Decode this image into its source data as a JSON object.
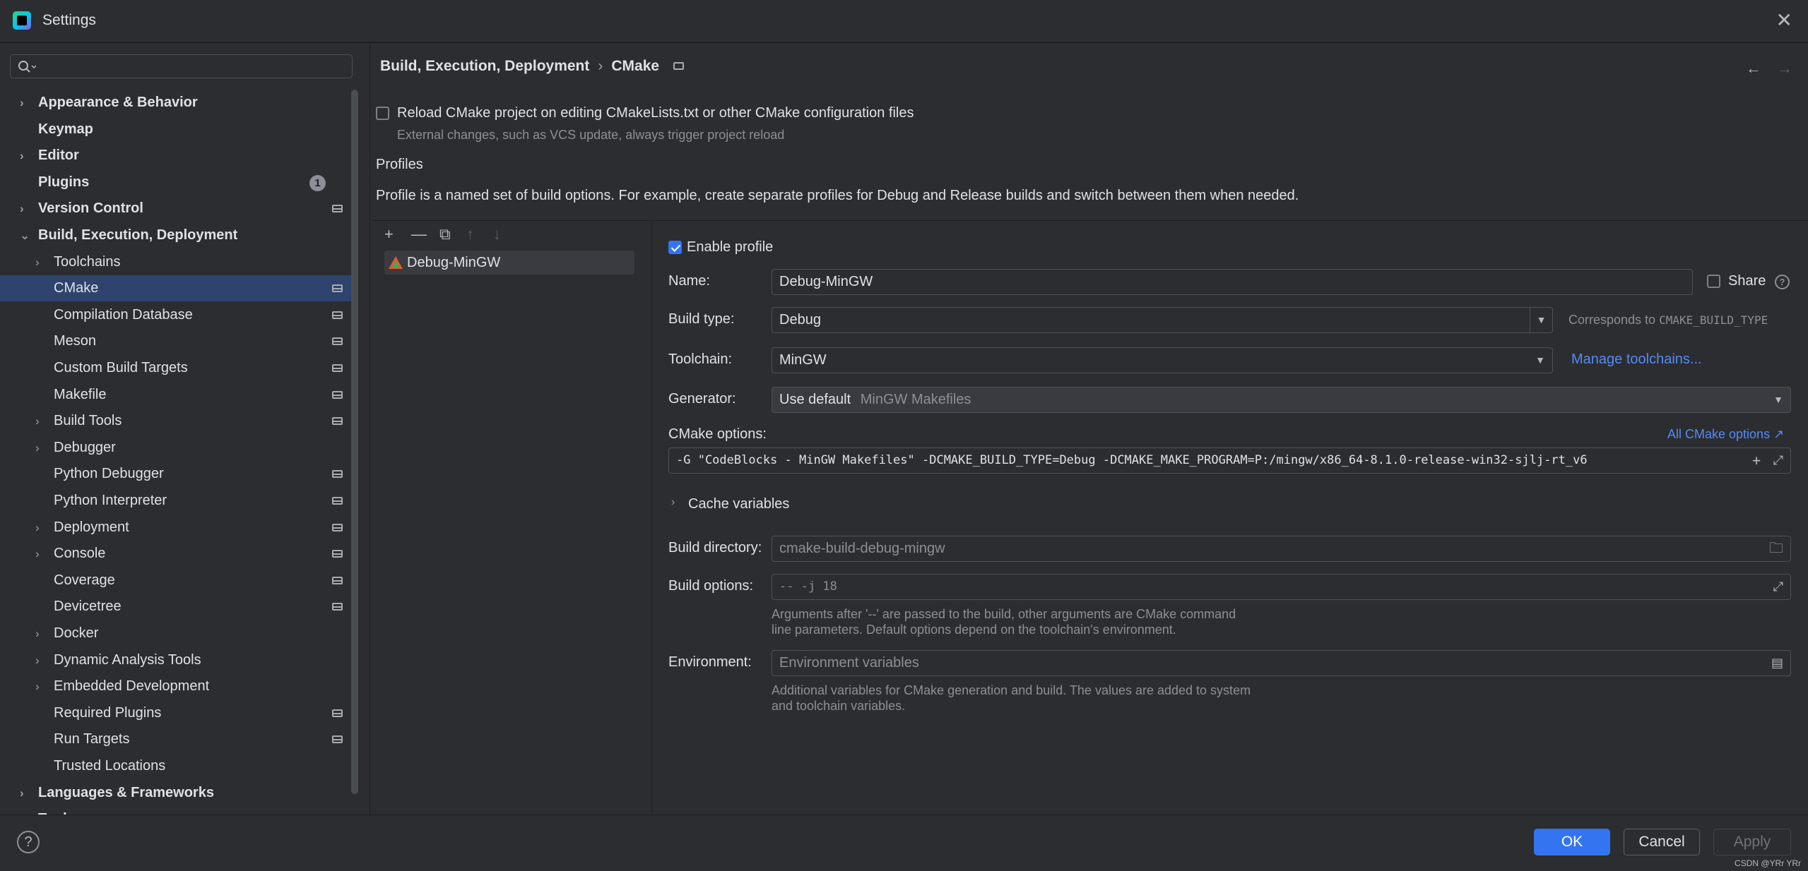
{
  "window": {
    "title": "Settings"
  },
  "sidebar": {
    "search_placeholder": "",
    "items": [
      {
        "label": "Appearance & Behavior",
        "bold": true,
        "chevron": "›",
        "indent": 0
      },
      {
        "label": "Keymap",
        "bold": true,
        "chevron": "",
        "indent": 0
      },
      {
        "label": "Editor",
        "bold": true,
        "chevron": "›",
        "indent": 0
      },
      {
        "label": "Plugins",
        "bold": true,
        "chevron": "",
        "indent": 0,
        "badge": "1"
      },
      {
        "label": "Version Control",
        "bold": true,
        "chevron": "›",
        "indent": 0,
        "project": true
      },
      {
        "label": "Build, Execution, Deployment",
        "bold": true,
        "chevron": "⌄",
        "indent": 0
      },
      {
        "label": "Toolchains",
        "chevron": "›",
        "indent": 1
      },
      {
        "label": "CMake",
        "chevron": "",
        "indent": 1,
        "project": true,
        "selected": true
      },
      {
        "label": "Compilation Database",
        "chevron": "",
        "indent": 1,
        "project": true
      },
      {
        "label": "Meson",
        "chevron": "",
        "indent": 1,
        "project": true
      },
      {
        "label": "Custom Build Targets",
        "chevron": "",
        "indent": 1,
        "project": true
      },
      {
        "label": "Makefile",
        "chevron": "",
        "indent": 1,
        "project": true
      },
      {
        "label": "Build Tools",
        "chevron": "›",
        "indent": 1,
        "project": true
      },
      {
        "label": "Debugger",
        "chevron": "›",
        "indent": 1
      },
      {
        "label": "Python Debugger",
        "chevron": "",
        "indent": 1,
        "project": true
      },
      {
        "label": "Python Interpreter",
        "chevron": "",
        "indent": 1,
        "project": true
      },
      {
        "label": "Deployment",
        "chevron": "›",
        "indent": 1,
        "project": true
      },
      {
        "label": "Console",
        "chevron": "›",
        "indent": 1,
        "project": true
      },
      {
        "label": "Coverage",
        "chevron": "",
        "indent": 1,
        "project": true
      },
      {
        "label": "Devicetree",
        "chevron": "",
        "indent": 1,
        "project": true
      },
      {
        "label": "Docker",
        "chevron": "›",
        "indent": 1
      },
      {
        "label": "Dynamic Analysis Tools",
        "chevron": "›",
        "indent": 1
      },
      {
        "label": "Embedded Development",
        "chevron": "›",
        "indent": 1
      },
      {
        "label": "Required Plugins",
        "chevron": "",
        "indent": 1,
        "project": true
      },
      {
        "label": "Run Targets",
        "chevron": "",
        "indent": 1,
        "project": true
      },
      {
        "label": "Trusted Locations",
        "chevron": "",
        "indent": 1
      },
      {
        "label": "Languages & Frameworks",
        "bold": true,
        "chevron": "›",
        "indent": 0
      },
      {
        "label": "Tools",
        "bold": true,
        "chevron": "›",
        "indent": 0
      }
    ]
  },
  "main": {
    "breadcrumb": {
      "parent": "Build, Execution, Deployment",
      "separator": "›",
      "current": "CMake"
    },
    "nav": {
      "back": "←",
      "forward": "→"
    },
    "reload": {
      "label": "Reload CMake project on editing CMakeLists.txt or other CMake configuration files",
      "hint": "External changes, such as VCS update, always trigger project reload",
      "checked": false
    },
    "profiles": {
      "heading": "Profiles",
      "description": "Profile is a named set of build options. For example, create separate profiles for Debug and Release builds and switch between them when needed.",
      "toolbar": {
        "add": "+",
        "remove": "—",
        "copy": "⧉",
        "up": "↑",
        "down": "↓"
      },
      "list": [
        "Debug-MinGW"
      ]
    },
    "form": {
      "enable_profile": "Enable profile",
      "name_label": "Name:",
      "name_value": "Debug-MinGW",
      "share_label": "Share",
      "build_type_label": "Build type:",
      "build_type_value": "Debug",
      "build_type_hint": "Corresponds to",
      "build_type_hint_code": "CMAKE_BUILD_TYPE",
      "toolchain_label": "Toolchain:",
      "toolchain_value": "MinGW",
      "manage_toolchains": "Manage toolchains...",
      "generator_label": "Generator:",
      "generator_value": "Use default",
      "generator_hint": "MinGW Makefiles",
      "cmake_options_label": "CMake options:",
      "all_cmake_options": "All CMake options ↗",
      "cmake_options_value": "-G \"CodeBlocks - MinGW Makefiles\" -DCMAKE_BUILD_TYPE=Debug -DCMAKE_MAKE_PROGRAM=P:/mingw/x86_64-8.1.0-release-win32-sjlj-rt_v6",
      "cache_variables": "Cache variables",
      "build_dir_label": "Build directory:",
      "build_dir_placeholder": "cmake-build-debug-mingw",
      "build_options_label": "Build options:",
      "build_options_placeholder": "-- -j 18",
      "build_options_hint_1": "Arguments after '--' are passed to the build, other arguments are CMake command",
      "build_options_hint_2": "line parameters. Default options depend on the toolchain's environment.",
      "environment_label": "Environment:",
      "environment_placeholder": "Environment variables",
      "environment_hint_1": "Additional variables for CMake generation and build. The values are added to system",
      "environment_hint_2": "and toolchain variables."
    }
  },
  "footer": {
    "help": "?",
    "ok": "OK",
    "cancel": "Cancel",
    "apply": "Apply",
    "watermark": "CSDN @YRr YRr"
  },
  "colors": {
    "accent": "#3574f0",
    "selection": "#2e436e",
    "link": "#548af7",
    "background": "#2b2d30"
  }
}
